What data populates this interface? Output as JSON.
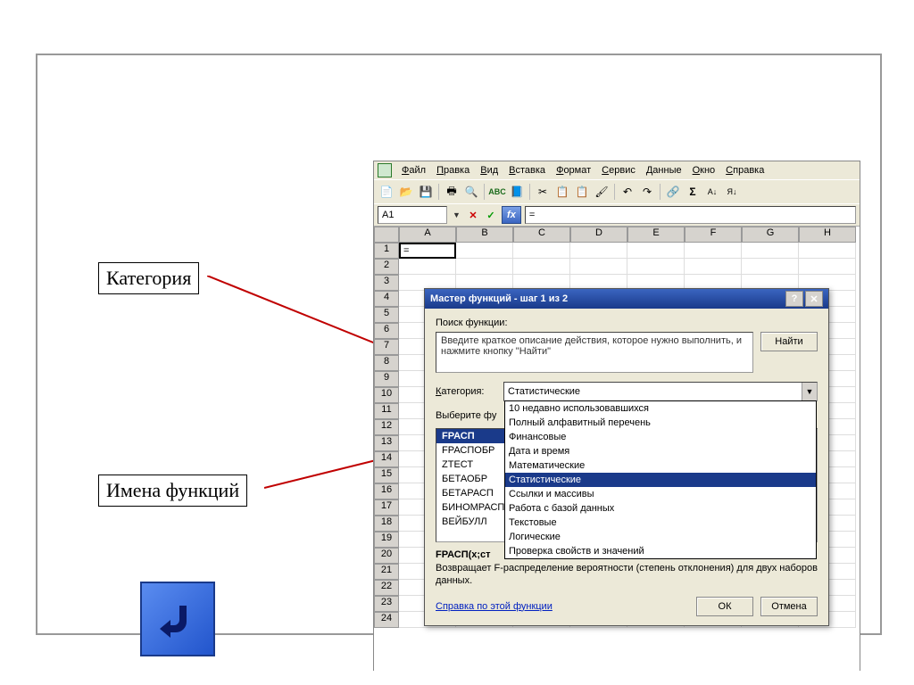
{
  "annotations": {
    "category": "Категория",
    "function_names": "Имена функций"
  },
  "menubar": [
    "Файл",
    "Правка",
    "Вид",
    "Вставка",
    "Формат",
    "Сервис",
    "Данные",
    "Окно",
    "Справка"
  ],
  "formula_bar": {
    "name_box": "A1",
    "value": "="
  },
  "columns": [
    "A",
    "B",
    "C",
    "D",
    "E",
    "F",
    "G",
    "H"
  ],
  "cell_A1": "=",
  "row_count": 24,
  "dialog": {
    "title": "Мастер функций - шаг 1 из 2",
    "search_label": "Поиск функции:",
    "search_text": "Введите краткое описание действия, которое нужно выполнить, и нажмите кнопку \"Найти\"",
    "find_btn": "Найти",
    "category_label": "Категория:",
    "category_selected": "Статистические",
    "category_options": [
      "10 недавно использовавшихся",
      "Полный алфавитный перечень",
      "Финансовые",
      "Дата и время",
      "Математические",
      "Статистические",
      "Ссылки и массивы",
      "Работа с базой данных",
      "Текстовые",
      "Логические",
      "Проверка свойств и значений"
    ],
    "select_fn_label": "Выберите фу",
    "functions": [
      "FРАСП",
      "FРАСПОБР",
      "ZТЕСТ",
      "БЕТАОБР",
      "БЕТАРАСП",
      "БИНОМРАСП",
      "ВЕЙБУЛЛ"
    ],
    "function_selected": "FРАСП",
    "signature": "FРАСП(x;ст",
    "description": "Возвращает F-распределение вероятности (степень отклонения) для двух наборов данных.",
    "help_link": "Справка по этой функции",
    "ok_btn": "ОК",
    "cancel_btn": "Отмена"
  }
}
